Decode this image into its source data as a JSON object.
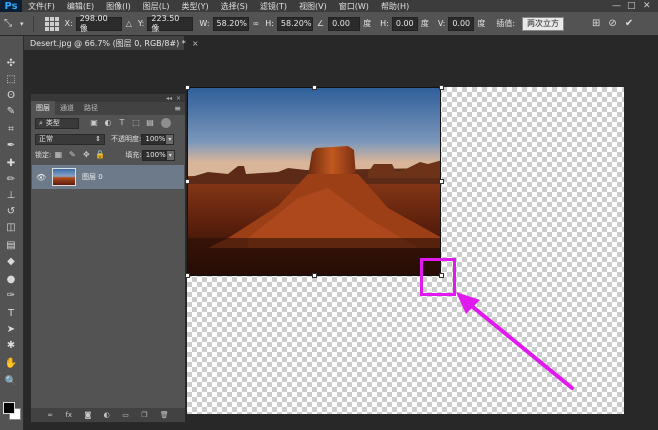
{
  "app": {
    "logo": "Ps"
  },
  "menu": [
    "文件(F)",
    "编辑(E)",
    "图像(I)",
    "图层(L)",
    "类型(Y)",
    "选择(S)",
    "滤镜(T)",
    "视图(V)",
    "窗口(W)",
    "帮助(H)"
  ],
  "window_controls": {
    "minimize": "—",
    "maximize": "□",
    "close": "✕"
  },
  "options_bar": {
    "x_label": "X:",
    "x_value": "298.00 像",
    "y_label": "Y:",
    "y_value": "223.50 像",
    "w_label": "W:",
    "w_value": "58.20%",
    "h_label": "H:",
    "h_value": "58.20%",
    "angle_value": "0.00",
    "angle_unit": "度",
    "hskew_label": "H:",
    "hskew_value": "0.00",
    "hskew_unit": "度",
    "vskew_label": "V:",
    "vskew_value": "0.00",
    "vskew_unit": "度",
    "interp_label": "插值:",
    "interp_value": "两次立方"
  },
  "document": {
    "tab_title": "Desert.jpg @ 66.7% (图层 0, RGB/8#) *",
    "tab_close": "×"
  },
  "panel": {
    "collapse": "◂◂",
    "close": "×",
    "tabs": [
      "图层",
      "通道",
      "路径"
    ],
    "menu_icon": "≡",
    "filter_label": "类型",
    "blend_mode": "正常",
    "opacity_label": "不透明度:",
    "opacity_value": "100%",
    "lock_label": "锁定:",
    "fill_label": "填充:",
    "fill_value": "100%",
    "layer_name": "图层 0",
    "bottom_icons": [
      "link-icon",
      "fx-icon",
      "mask-icon",
      "adjustment-icon",
      "group-icon",
      "new-layer-icon",
      "trash-icon"
    ],
    "bottom_glyphs": [
      "∞",
      "fx",
      "◙",
      "◐",
      "▭",
      "❐",
      "🗑"
    ]
  },
  "colors": {
    "highlight": "#e01aef",
    "sky_top": "#3a6ea8",
    "rock": "#b24a1e"
  }
}
